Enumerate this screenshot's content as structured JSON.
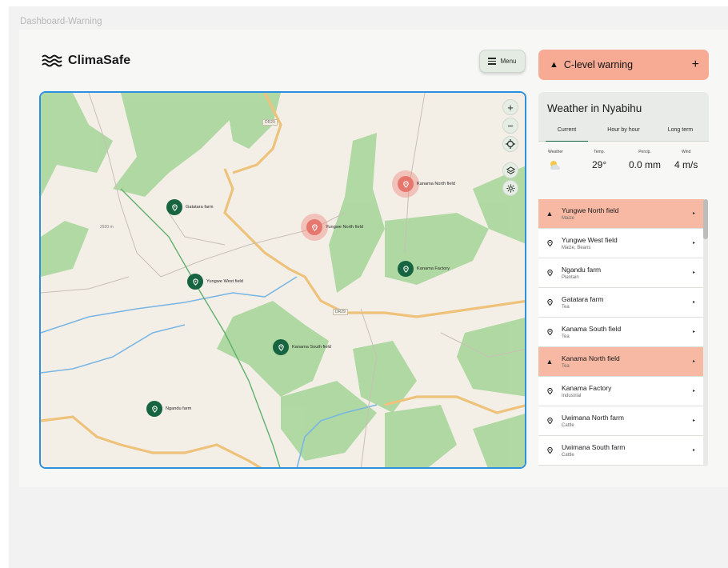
{
  "frame_title": "Dashboard-Warning",
  "app": {
    "name": "ClimaSafe"
  },
  "menu": {
    "label": "Menu"
  },
  "warning": {
    "label": "C-level warning",
    "add": "+"
  },
  "weather": {
    "title": "Weather in Nyabihu",
    "tabs": [
      "Current",
      "Hour by hour",
      "Long term"
    ],
    "headers": {
      "weather": "Weather",
      "temp": "Temp.",
      "precip": "Percip.",
      "wind": "Wind"
    },
    "values": {
      "temp": "29°",
      "precip": "0.0 mm",
      "wind": "4 m/s"
    }
  },
  "map": {
    "controls": {
      "zoom_in": "+",
      "zoom_out": "−"
    },
    "markers": [
      {
        "label": "Gatatara farm",
        "warn": false
      },
      {
        "label": "Yungwe North field",
        "warn": true
      },
      {
        "label": "Kanama North field",
        "warn": true
      },
      {
        "label": "Kanama Factory",
        "warn": false
      },
      {
        "label": "Yungwe West field",
        "warn": false
      },
      {
        "label": "Kanama South field",
        "warn": false
      },
      {
        "label": "Ngandu farm",
        "warn": false
      }
    ],
    "road_labels": [
      "DR29",
      "DR29"
    ],
    "elevation": "2920 m"
  },
  "fields": [
    {
      "name": "Yungwe North field",
      "sub": "Maize",
      "warn": true
    },
    {
      "name": "Yungwe West field",
      "sub": "Maize, Beans",
      "warn": false
    },
    {
      "name": "Ngandu farm",
      "sub": "Plantain",
      "warn": false
    },
    {
      "name": "Gatatara farm",
      "sub": "Tea",
      "warn": false
    },
    {
      "name": "Kanama South field",
      "sub": "Tea",
      "warn": false
    },
    {
      "name": "Kanama North field",
      "sub": "Tea",
      "warn": true
    },
    {
      "name": "Kanama Factory",
      "sub": "Industrial",
      "warn": false
    },
    {
      "name": "Uwimana North farm",
      "sub": "Cattle",
      "warn": false
    },
    {
      "name": "Uwimana South farm",
      "sub": "Cattle",
      "warn": false
    }
  ],
  "colors": {
    "brand": "#176440",
    "warning": "#f7ab94",
    "warning_row": "#f7b8a4",
    "map_border": "#2d8fe0"
  }
}
